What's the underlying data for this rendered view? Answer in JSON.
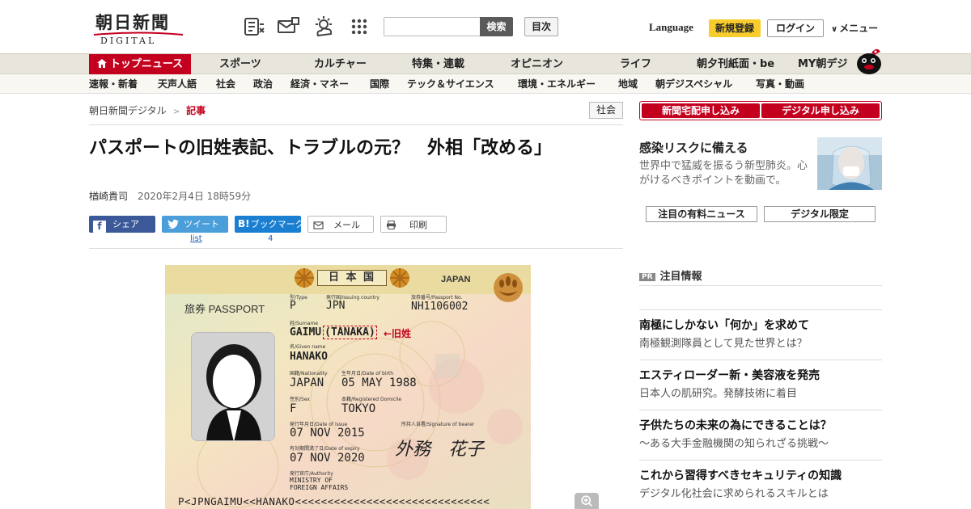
{
  "header": {
    "logo_main": "朝日新聞",
    "logo_sub": "DIGITAL",
    "icons": [
      "newspaper-icon",
      "mail-delivery-icon",
      "weather-icon",
      "grid-apps-icon"
    ],
    "search": {
      "placeholder": "",
      "value": "",
      "button": "検索"
    },
    "toc_button": "目次",
    "language": "Language",
    "signup": "新規登録",
    "login": "ログイン",
    "menu": "メニュー"
  },
  "nav_primary": {
    "items": [
      "トップニュース",
      "スポーツ",
      "カルチャー",
      "特集・連載",
      "オピニオン",
      "ライフ",
      "朝夕刊紙面・be",
      "MY朝デジ"
    ],
    "active_color": "#c4001f"
  },
  "nav_secondary": {
    "items": [
      "速報・新着",
      "天声人語",
      "社会",
      "政治",
      "経済・マネー",
      "国際",
      "テック＆サイエンス",
      "環境・エネルギー",
      "地域",
      "朝デジスペシャル",
      "写真・動画"
    ]
  },
  "breadcrumb": {
    "home": "朝日新聞デジタル",
    "separator": ">",
    "current": "記事"
  },
  "category_badge": "社会",
  "article": {
    "headline": "パスポートの旧姓表記、トラブルの元？　外相「改める」",
    "author": "楢崎貴司",
    "date": "2020年2月4日 18時59分"
  },
  "share": {
    "facebook": "シェア",
    "twitter": "ツイート",
    "hatena": "ブックマーク",
    "mail": "メール",
    "print": "印刷",
    "twitter_count": "list",
    "hatena_count": "4"
  },
  "passport": {
    "country": "日 本 国",
    "country_en": "JAPAN",
    "doc_label": "旅券 PASSPORT",
    "type_label": "型/Type",
    "type": "P",
    "issuing_label": "発行国/Issuing country",
    "issuing": "JPN",
    "passport_no_label": "旅券番号/Passport No.",
    "passport_no": "NH1106002",
    "surname_label": "姓/Surname",
    "surname": "GAIMU",
    "old_surname": "TANAKA",
    "old_surname_note": "←旧姓",
    "given_label": "名/Given name",
    "given": "HANAKO",
    "nationality_label": "国籍/Nationality",
    "nationality": "JAPAN",
    "dob_label": "生年月日/Date of birth",
    "dob": "05 MAY 1988",
    "sex_label": "性別/Sex",
    "sex": "F",
    "domicile_label": "本籍/Registered Domicile",
    "domicile": "TOKYO",
    "issue_label": "発行年月日/Date of issue",
    "issue": "07 NOV 2015",
    "signature_label": "所持人自署/Signature of bearer",
    "signature": "外務　花子",
    "expiry_label": "有効期間満了日/Date of expiry",
    "expiry": "07 NOV 2020",
    "authority_label": "発行官庁/Authority",
    "authority1": "MINISTRY OF",
    "authority2": "FOREIGN AFFAIRS",
    "mrz": "P<JPNGAIMU<<HANAKO<<<<<<<<<<<<<<<<<<<<<<<<<<<<<<"
  },
  "sidebar": {
    "subscribe_paper": "新聞宅配申し込み",
    "subscribe_digital": "デジタル申し込み",
    "promo_title": "感染リスクに備える",
    "promo_text": "世界中で猛威を振るう新型肺炎。心がけるべきポイントを動画で。",
    "pill_paid": "注目の有料ニュース",
    "pill_digital": "デジタル限定",
    "pr_tag": "PR",
    "pr_heading": "注目情報",
    "pr_items": [
      {
        "title": "南極にしかない「何か」を求めて",
        "sub": "南極観測隊員として見た世界とは？"
      },
      {
        "title": "エスティローダー新・美容液を発売",
        "sub": "日本人の肌研究。発酵技術に着目"
      },
      {
        "title": "子供たちの未来の為にできることは？",
        "sub": "～ある大手金融機関の知られざる挑戦～"
      },
      {
        "title": "これから習得すべきセキュリティの知識",
        "sub": "デジタル化社会に求められるスキルとは"
      }
    ]
  }
}
